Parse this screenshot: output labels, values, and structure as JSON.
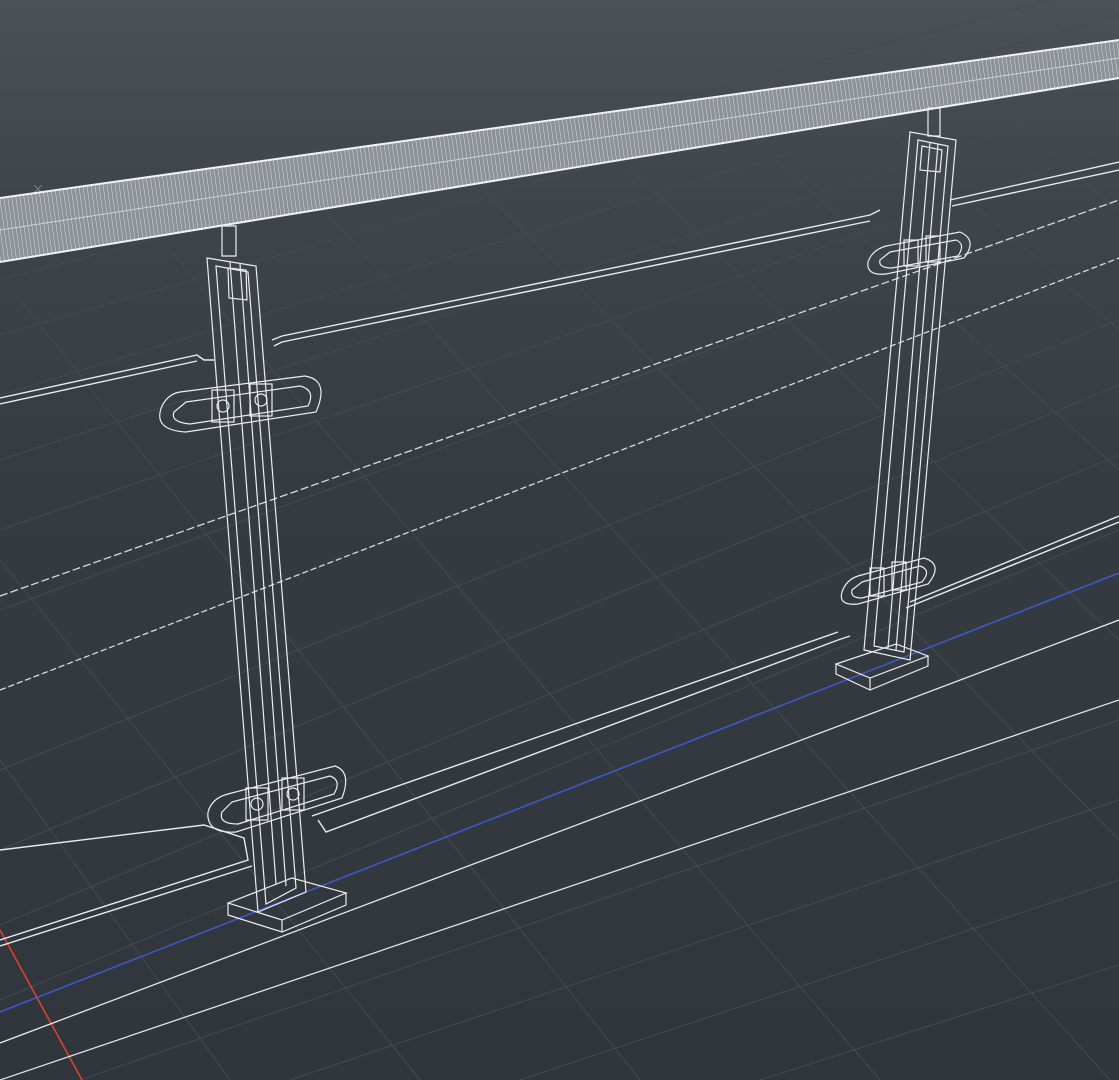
{
  "viewport": {
    "mode": "wireframe",
    "background_color": "#3a4046",
    "grid_color": "#454b51",
    "wire_color": "#e8ebee",
    "axis_x_color": "#d8432f",
    "axis_y_color": "#3f56c8",
    "model": "glass-railing-with-two-posts-and-handrail",
    "icons": {
      "origin": "origin-marker-icon"
    }
  }
}
